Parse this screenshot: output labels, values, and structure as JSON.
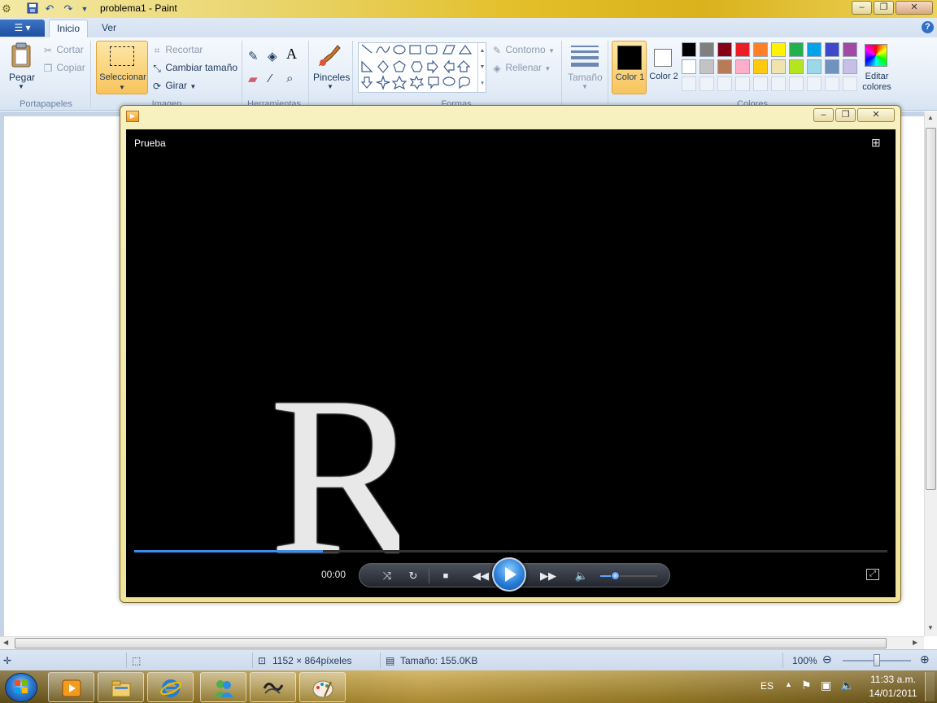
{
  "paint": {
    "window_title": "problema1 - Paint",
    "tabs": [
      "Inicio",
      "Ver"
    ],
    "clipboard": {
      "paste": "Pegar",
      "cut": "Cortar",
      "copy": "Copiar",
      "group": "Portapapeles"
    },
    "image": {
      "select": "Seleccionar",
      "crop": "Recortar",
      "resize": "Cambiar tamaño",
      "rotate": "Girar",
      "group": "Imagen"
    },
    "tools": {
      "group": "Herramientas"
    },
    "brushes": {
      "label": "Pinceles"
    },
    "shapes": {
      "outline": "Contorno",
      "fill": "Rellenar",
      "group": "Formas"
    },
    "size": {
      "label": "Tamaño"
    },
    "colors": {
      "color1_label": "Color 1",
      "color2_label": "Color 2",
      "edit_label": "Editar colores",
      "group": "Colores",
      "color1": "#000000",
      "color2": "#ffffff",
      "palette_row1": [
        "#000000",
        "#7f7f7f",
        "#880015",
        "#ed1c24",
        "#ff7f27",
        "#fff200",
        "#22b14c",
        "#00a2e8",
        "#3f48cc",
        "#a349a4"
      ],
      "palette_row2": [
        "#ffffff",
        "#c3c3c3",
        "#b97a57",
        "#ffaec9",
        "#ffc90e",
        "#efe4b0",
        "#b5e61d",
        "#99d9ea",
        "#7092be",
        "#c8bfe7"
      ]
    },
    "status": {
      "dimensions": "1152 × 864píxeles",
      "file_size": "Tamaño: 155.0KB",
      "zoom": "100%"
    }
  },
  "player": {
    "title": "Prueba",
    "time": "00:00",
    "video_letter": "R",
    "seek_progress": 0.25,
    "volume_level": 0.25
  },
  "taskbar": {
    "language": "ES",
    "time": "11:33 a.m.",
    "date": "14/01/2011"
  }
}
